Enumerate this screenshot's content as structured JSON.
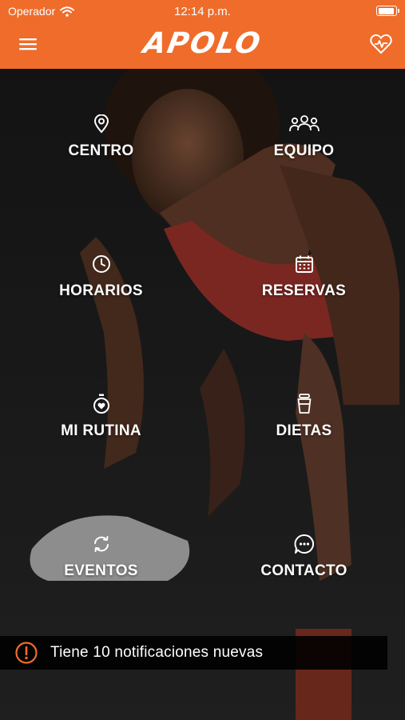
{
  "status_bar": {
    "carrier": "Operador",
    "time": "12:14 p.m."
  },
  "header": {
    "logo": "APOLO",
    "accent_color": "#ef6c2a"
  },
  "menu": [
    {
      "id": "centro",
      "label": "CENTRO",
      "icon": "location-pin-icon"
    },
    {
      "id": "equipo",
      "label": "EQUIPO",
      "icon": "team-icon"
    },
    {
      "id": "horarios",
      "label": "HORARIOS",
      "icon": "clock-icon"
    },
    {
      "id": "reservas",
      "label": "RESERVAS",
      "icon": "calendar-icon"
    },
    {
      "id": "mi-rutina",
      "label": "MI RUTINA",
      "icon": "stopwatch-heart-icon"
    },
    {
      "id": "dietas",
      "label": "DIETAS",
      "icon": "cup-icon"
    },
    {
      "id": "eventos",
      "label": "EVENTOS",
      "icon": "refresh-icon"
    },
    {
      "id": "contacto",
      "label": "CONTACTO",
      "icon": "chat-bubble-icon"
    }
  ],
  "notification": {
    "text": "Tiene 10 notificaciones nuevas",
    "icon": "alert-circle-icon",
    "icon_color": "#ef6c2a"
  }
}
